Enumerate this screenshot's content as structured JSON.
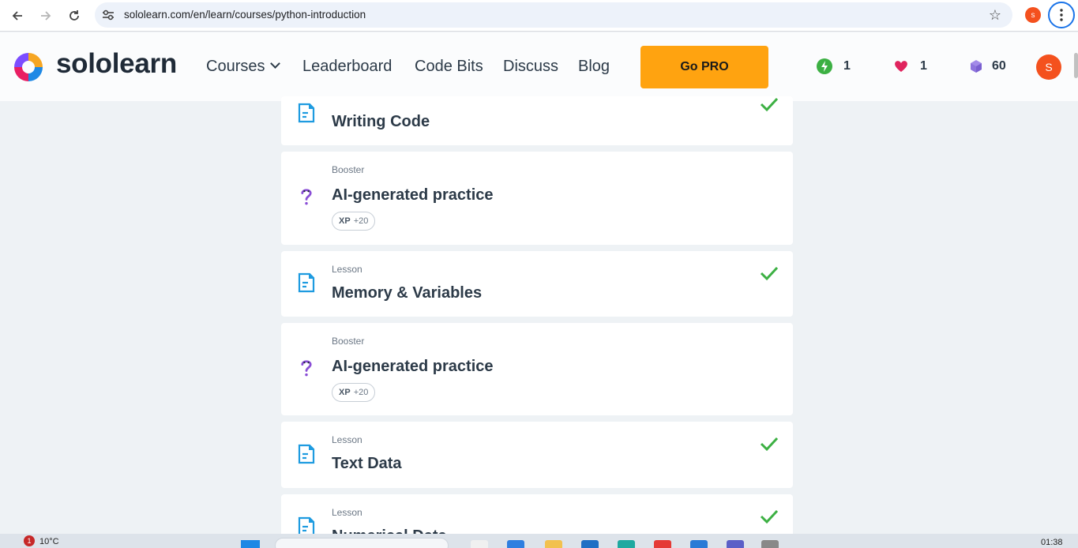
{
  "browser": {
    "url": "sololearn.com/en/learn/courses/python-introduction",
    "profile_initial": "S",
    "icons": {
      "back": "arrow-left-icon",
      "forward": "arrow-right-icon",
      "reload": "reload-icon",
      "site_info": "tune-icon",
      "bookmark": "star-icon",
      "menu": "kebab-menu-icon"
    }
  },
  "header": {
    "logo_text": "sololearn",
    "nav": {
      "courses": "Courses",
      "leaderboard": "Leaderboard",
      "code_bits": "Code Bits",
      "discuss": "Discuss",
      "blog": "Blog"
    },
    "go_pro": "Go PRO",
    "stats": {
      "streak": "1",
      "hearts": "1",
      "bits": "60"
    },
    "avatar_initial": "S",
    "colors": {
      "accent": "#ffa310",
      "streak": "#3cb043",
      "heart": "#e0245e",
      "bits": "#8b6bd9"
    }
  },
  "cards": [
    {
      "type": "",
      "title": "Writing Code",
      "icon": "lesson-icon",
      "completed": true
    },
    {
      "type": "Booster",
      "title": "AI-generated practice",
      "icon": "question-icon",
      "xp_label": "XP",
      "xp_value": "+20"
    },
    {
      "type": "Lesson",
      "title": "Memory & Variables",
      "icon": "lesson-icon",
      "completed": true
    },
    {
      "type": "Booster",
      "title": "AI-generated practice",
      "icon": "question-icon",
      "xp_label": "XP",
      "xp_value": "+20"
    },
    {
      "type": "Lesson",
      "title": "Text Data",
      "icon": "lesson-icon",
      "completed": true
    },
    {
      "type": "Lesson",
      "title": "Numerical Data",
      "icon": "lesson-icon",
      "completed": true
    }
  ],
  "taskbar": {
    "weather_alerts": "1",
    "temperature": "10°C",
    "time": "01:38"
  }
}
